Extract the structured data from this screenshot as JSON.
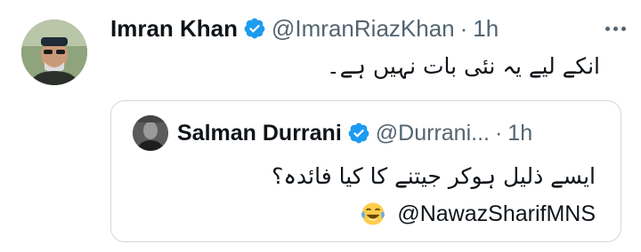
{
  "tweet": {
    "author_name": "Imran Khan",
    "handle": "@ImranRiazKhan",
    "separator": "·",
    "time": "1h",
    "text": "انکے لیے یہ نئی بات نہیں ہے۔",
    "verified_icon": "verified-badge-icon",
    "more_icon": "more-options-icon"
  },
  "quote": {
    "author_name": "Salman Durrani",
    "handle": "@Durrani...",
    "separator": "·",
    "time": "1h",
    "text_line1": "ایسے ذلیل ہوکر جیتنے کا کیا فائدہ؟",
    "mention": "@NawazSharifMNS",
    "emoji_icon": "laughing-crying-face-icon"
  },
  "colors": {
    "verified": "#1d9bf0",
    "secondary_text": "#536471",
    "border": "#cfd9de"
  }
}
